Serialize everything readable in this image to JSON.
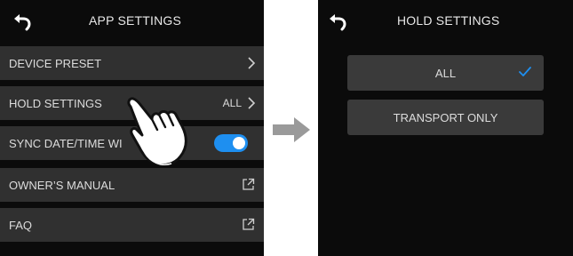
{
  "app_settings": {
    "title": "APP SETTINGS",
    "items": [
      {
        "label": "DEVICE PRESET",
        "icon": "chevron-right-icon"
      },
      {
        "label": "HOLD SETTINGS",
        "value": "ALL",
        "icon": "chevron-right-icon"
      },
      {
        "label": "SYNC DATE/TIME WI",
        "toggle_on": true
      },
      {
        "label": "OWNER’S MANUAL",
        "icon": "external-link-icon"
      },
      {
        "label": "FAQ",
        "icon": "external-link-icon"
      }
    ]
  },
  "hold_settings": {
    "title": "HOLD SETTINGS",
    "options": [
      {
        "label": "ALL",
        "selected": true
      },
      {
        "label": "TRANSPORT ONLY",
        "selected": false
      }
    ]
  },
  "colors": {
    "background": "#0b0b0b",
    "row": "#303030",
    "option": "#3a3a3a",
    "accent": "#1e8ff0",
    "arrow": "#9a9a9a"
  },
  "icons": [
    "back-arrow-icon",
    "chevron-right-icon",
    "external-link-icon",
    "toggle-switch",
    "tap-hand-icon",
    "flow-arrow-icon",
    "checkmark-icon"
  ]
}
